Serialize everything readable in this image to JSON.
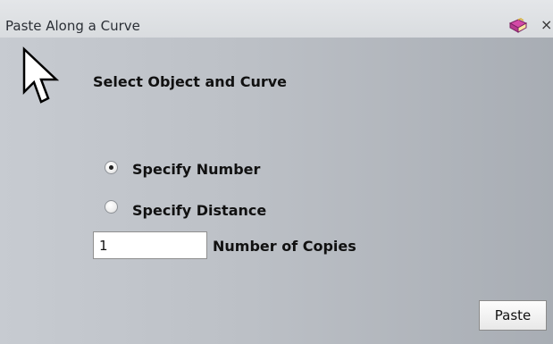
{
  "window": {
    "title": "Paste Along a Curve",
    "close_glyph": "×"
  },
  "main": {
    "instruction": "Select Object and Curve",
    "options": [
      {
        "label": "Specify Number",
        "checked": true
      },
      {
        "label": "Specify Distance",
        "checked": false
      }
    ],
    "copies_value": "1",
    "copies_label": "Number of Copies",
    "paste_label": "Paste"
  },
  "icons": {
    "help": "book-help-icon",
    "close": "close-icon",
    "cursor": "arrow-cursor-icon"
  },
  "colors": {
    "titlebar": "#e0e2e5",
    "panel_start": "#c7cbd1",
    "panel_end": "#a8adb4"
  }
}
